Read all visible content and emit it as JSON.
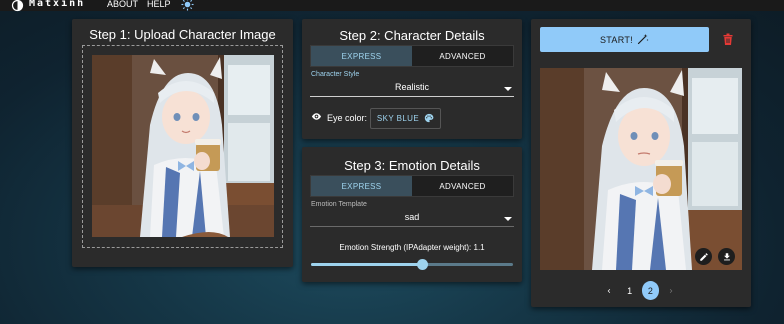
{
  "app": {
    "brand": "Matxinh",
    "nav": [
      "ABOUT",
      "HELP"
    ]
  },
  "step1": {
    "title": "Step 1: Upload Character Image"
  },
  "step2": {
    "title": "Step 2: Character Details",
    "tabs": [
      "EXPRESS",
      "ADVANCED"
    ],
    "style_label": "Character Style",
    "style_value": "Realistic",
    "eye_label": "Eye color:",
    "eye_value": "SKY BLUE",
    "eye_color": "#87ceeb"
  },
  "step3": {
    "title": "Step 3: Emotion Details",
    "tabs": [
      "EXPRESS",
      "ADVANCED"
    ],
    "template_label": "Emotion Template",
    "template_value": "sad",
    "strength_label": "Emotion Strength (IPAdapter weight): 1.1",
    "strength_fraction": 0.55
  },
  "result": {
    "start_label": "START!",
    "pages": [
      "1",
      "2"
    ],
    "current_page": "2"
  },
  "colors": {
    "accent": "#90caf9",
    "delete": "#e53935",
    "card": "#2b2b2b"
  },
  "icons": [
    "logo-icon",
    "brightness-icon",
    "eye-icon",
    "palette-icon",
    "magic-wand-icon",
    "trash-icon",
    "pencil-icon",
    "download-icon",
    "chevron-left-icon",
    "chevron-right-icon"
  ]
}
